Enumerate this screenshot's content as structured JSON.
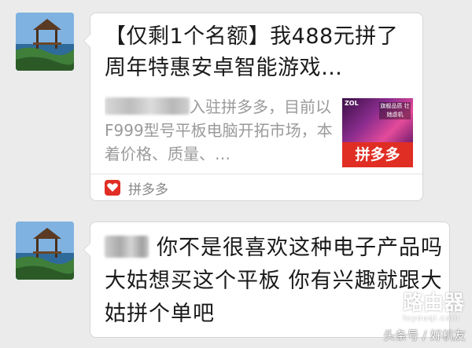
{
  "share_card": {
    "title": "【仅剩1个名额】我488元拼了周年特惠安卓智能游戏…",
    "description": "入驻拼多多，目前以F999型号平板电脑开拓市场，本着价格、质量、…",
    "thumbnail": {
      "brand": "ZOL",
      "tag": "旗舰品质 壮她虐机",
      "banner": "拼多多"
    },
    "source_app": "拼多多"
  },
  "message": {
    "text": "你不是很喜欢这种电子产品吗 大姑想买这个平板 你有兴趣就跟大姑拼个单吧"
  },
  "watermarks": {
    "router_brand": "路由器",
    "router_url": "luyouqi.com",
    "toutiao": "头条号 / 好机友"
  },
  "colors": {
    "background": "#ebebeb",
    "bubble": "#ffffff",
    "pdd_red": "#e02e24"
  }
}
